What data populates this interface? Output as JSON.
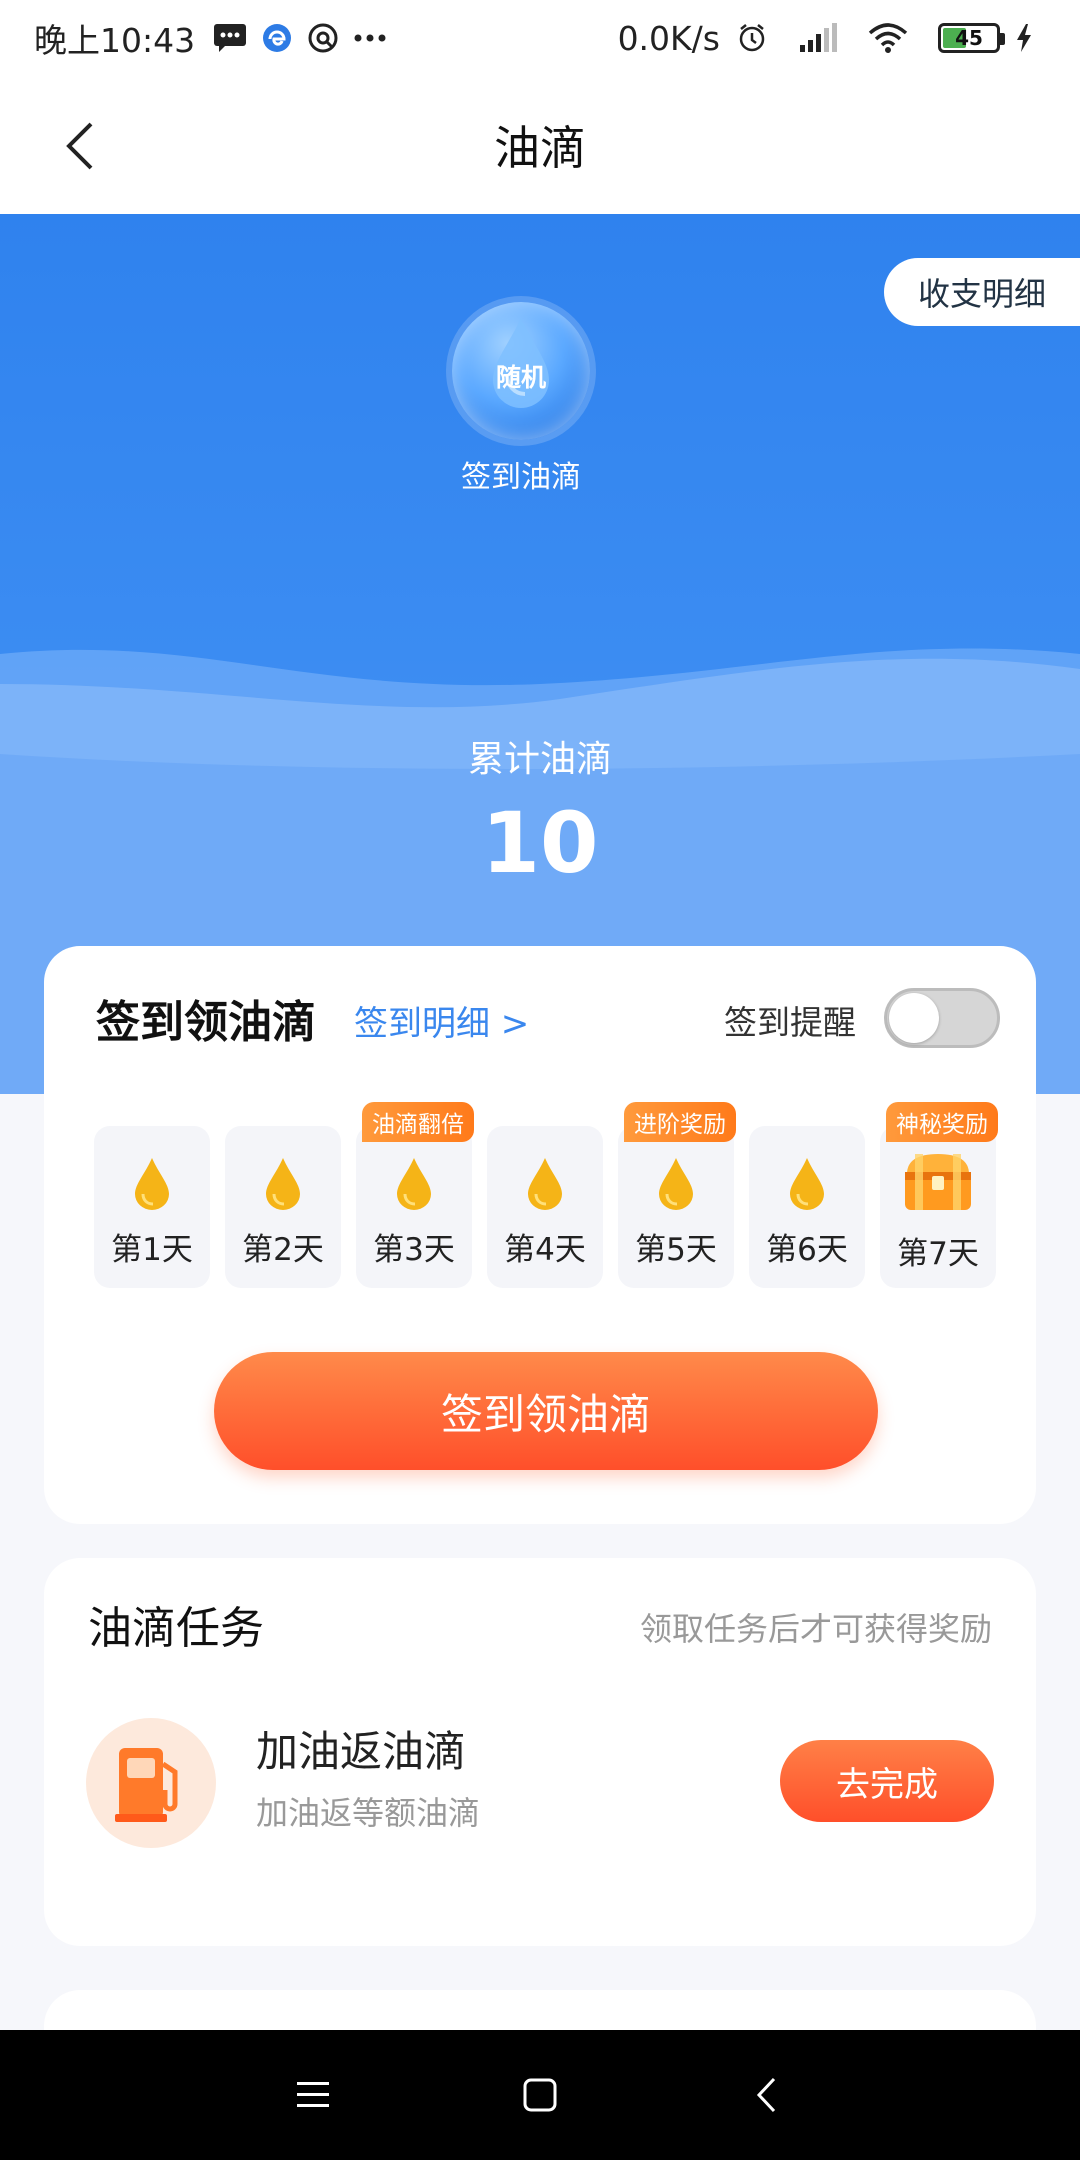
{
  "status_bar": {
    "time": "晚上10:43",
    "network_speed": "0.0K/s",
    "battery_level": "45"
  },
  "nav": {
    "title": "油滴",
    "back_icon": "chevron-left-icon"
  },
  "hero": {
    "detail_button": "收支明细",
    "orb_text": "随机",
    "orb_label": "签到油滴",
    "total_label": "累计油滴",
    "total_value": "10"
  },
  "checkin": {
    "title": "签到领油滴",
    "detail_link": "签到明细 >",
    "remind_label": "签到提醒",
    "remind_enabled": false,
    "days": [
      {
        "label": "第1天",
        "badge": ""
      },
      {
        "label": "第2天",
        "badge": ""
      },
      {
        "label": "第3天",
        "badge": "油滴翻倍"
      },
      {
        "label": "第4天",
        "badge": ""
      },
      {
        "label": "第5天",
        "badge": "进阶奖励"
      },
      {
        "label": "第6天",
        "badge": ""
      },
      {
        "label": "第7天",
        "badge": "神秘奖励",
        "icon": "treasure-chest-icon"
      }
    ],
    "cta_label": "签到领油滴"
  },
  "tasks": {
    "title": "油滴任务",
    "hint": "领取任务后才可获得奖励",
    "items": [
      {
        "name": "加油返油滴",
        "desc": "加油返等额油滴",
        "button": "去完成",
        "icon": "fuel-pump-icon"
      }
    ]
  },
  "colors": {
    "primary_blue": "#2f82ee",
    "accent_orange": "#ff5a2c",
    "badge_orange": "#ff8a2a",
    "drop_yellow": "#f5b417"
  }
}
